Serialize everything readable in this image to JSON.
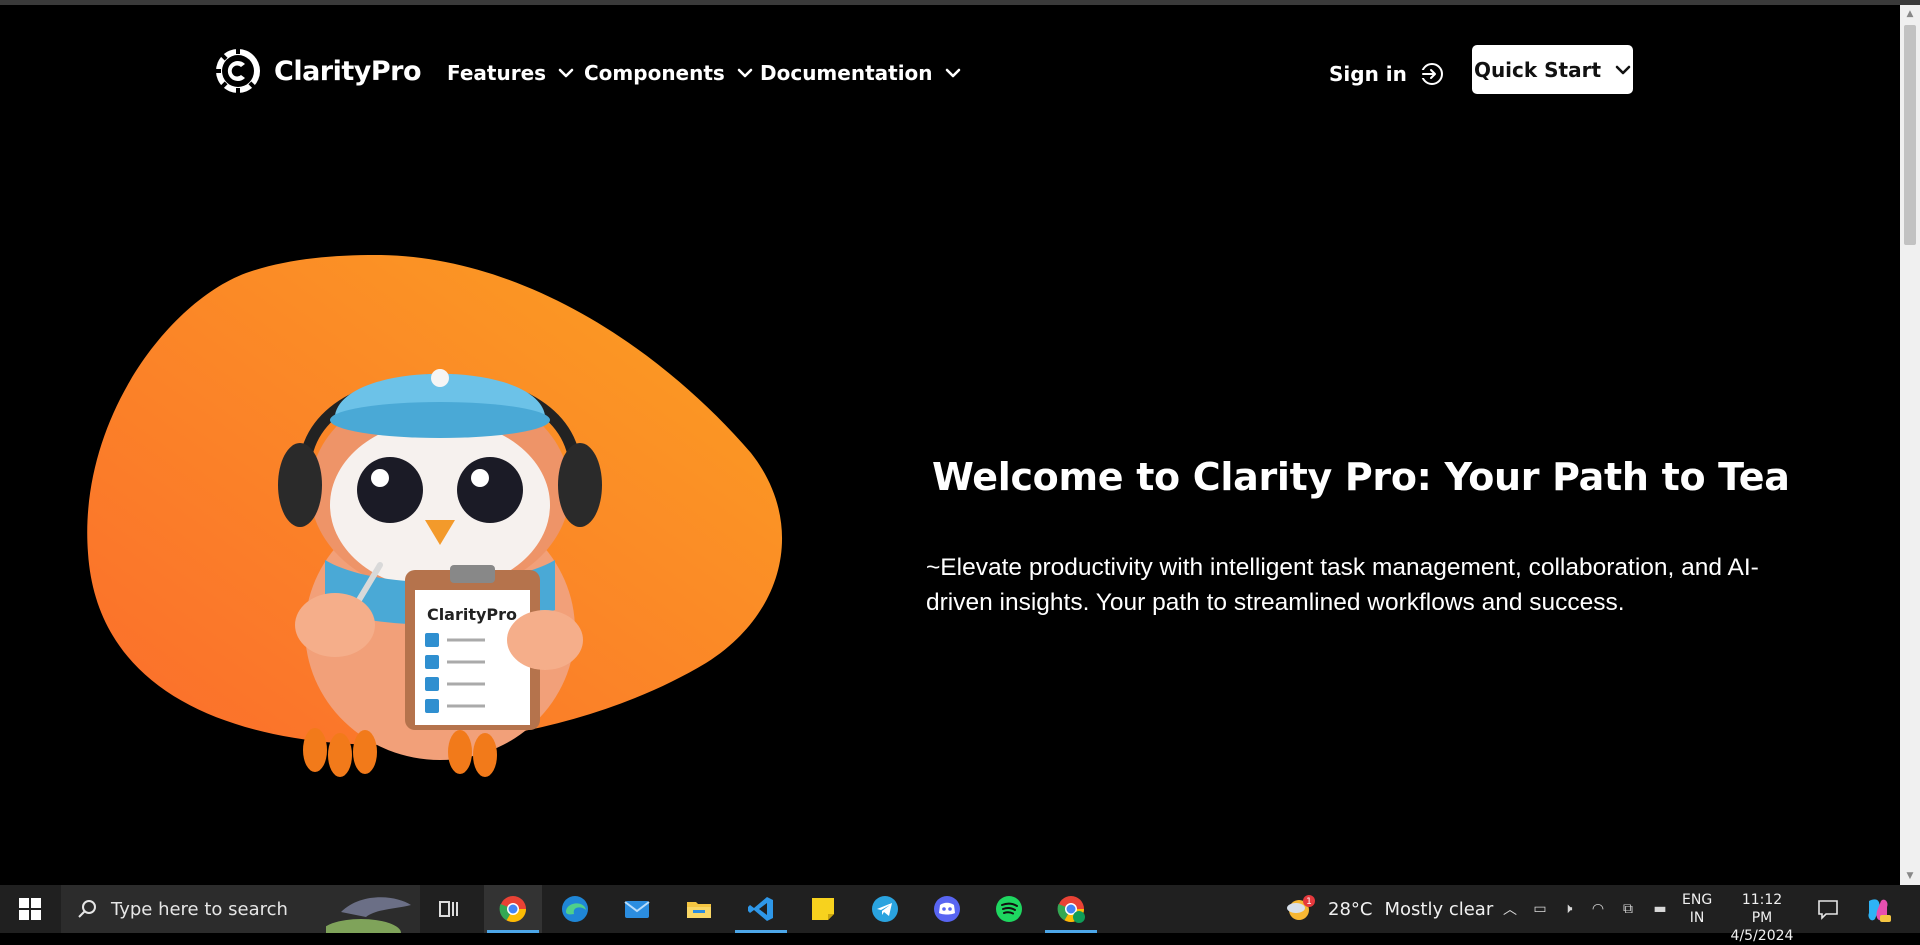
{
  "brand": {
    "name": "ClarityPro"
  },
  "nav": {
    "items": [
      {
        "label": "Features"
      },
      {
        "label": "Components"
      },
      {
        "label": "Documentation"
      }
    ],
    "signin_label": "Sign in",
    "quickstart_label": "Quick Start"
  },
  "hero": {
    "headline": "Welcome to Clarity Pro: Your Path to Team Co",
    "subtext": "~Elevate productivity with intelligent task management, collaboration, and AI-driven insights. Your path to streamlined workflows and success.",
    "mascot_badge": "ClarityPro"
  },
  "colors": {
    "background": "#000000",
    "accent_orange": "#f7931e",
    "button_bg": "#ffffff"
  },
  "taskbar": {
    "search_placeholder": "Type here to search",
    "apps": [
      "task-view",
      "chrome",
      "edge",
      "mail",
      "file-explorer",
      "vscode",
      "sticky-notes",
      "telegram",
      "discord",
      "spotify",
      "chrome-profile"
    ],
    "weather": {
      "temp": "28°C",
      "condition": "Mostly clear",
      "badge": "1"
    },
    "lang": {
      "line1": "ENG",
      "line2": "IN"
    },
    "clock": {
      "time": "11:12 PM",
      "date": "4/5/2024"
    }
  }
}
